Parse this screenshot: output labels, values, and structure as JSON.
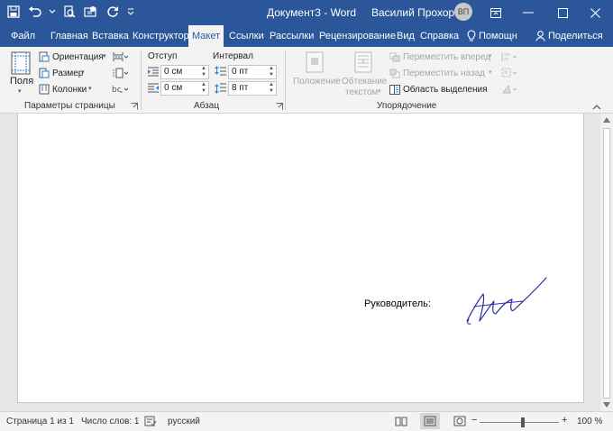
{
  "window": {
    "title": "Документ3  -  Word",
    "user": "Василий Прохоров",
    "initials": "ВП"
  },
  "tabs": [
    {
      "label": "Файл"
    },
    {
      "label": "Главная"
    },
    {
      "label": "Вставка"
    },
    {
      "label": "Конструктор"
    },
    {
      "label": "Макет"
    },
    {
      "label": "Ссылки"
    },
    {
      "label": "Рассылки"
    },
    {
      "label": "Рецензирование"
    },
    {
      "label": "Вид"
    },
    {
      "label": "Справка"
    },
    {
      "label": "Помощн"
    },
    {
      "label": "Поделиться"
    }
  ],
  "ribbon": {
    "page_setup": {
      "group_label": "Параметры страницы",
      "margins": "Поля",
      "orientation": "Ориентация",
      "size": "Размер",
      "columns": "Колонки"
    },
    "paragraph": {
      "group_label": "Абзац",
      "indent_label": "Отступ",
      "spacing_label": "Интервал",
      "indent_left": "0 см",
      "indent_right": "0 см",
      "spacing_before": "0 пт",
      "spacing_after": "8 пт"
    },
    "arrange": {
      "group_label": "Упорядочение",
      "position": "Положение",
      "wrap_line1": "Обтекание",
      "wrap_line2": "текстом",
      "bring_forward": "Переместить вперед",
      "send_backward": "Переместить назад",
      "selection_pane": "Область выделения"
    }
  },
  "document": {
    "text": "Руководитель:"
  },
  "status": {
    "page": "Страница 1 из 1",
    "words": "Число слов: 1",
    "language": "русский",
    "zoom": "100 %"
  }
}
